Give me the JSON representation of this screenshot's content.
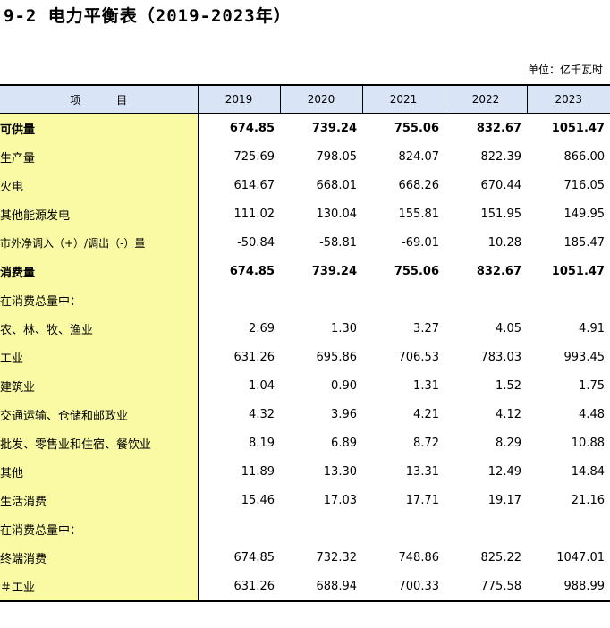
{
  "title": "9-2  电力平衡表（2019-2023年）",
  "unit": "单位：亿千瓦时",
  "table": {
    "header_item": "项   目",
    "years": [
      "2019",
      "2020",
      "2021",
      "2022",
      "2023"
    ]
  },
  "rows": [
    {
      "label": "可供量",
      "level": 0,
      "bold": true,
      "values": [
        "674.85",
        "739.24",
        "755.06",
        "832.67",
        "1051.47"
      ]
    },
    {
      "label": "生产量",
      "level": 1,
      "bold": false,
      "values": [
        "725.69",
        "798.05",
        "824.07",
        "822.39",
        "866.00"
      ]
    },
    {
      "label": "火电",
      "level": 2,
      "bold": false,
      "values": [
        "614.67",
        "668.01",
        "668.26",
        "670.44",
        "716.05"
      ]
    },
    {
      "label": "其他能源发电",
      "level": 2,
      "bold": false,
      "values": [
        "111.02",
        "130.04",
        "155.81",
        "151.95",
        "149.95"
      ]
    },
    {
      "label": "市外净调入（+）/调出（-）量",
      "level": 3,
      "bold": false,
      "values": [
        "-50.84",
        "-58.81",
        "-69.01",
        "10.28",
        "185.47"
      ]
    },
    {
      "label": "消费量",
      "level": 0,
      "bold": true,
      "values": [
        "674.85",
        "739.24",
        "755.06",
        "832.67",
        "1051.47"
      ]
    },
    {
      "label": "在消费总量中：",
      "level": 1,
      "bold": false,
      "values": [
        "",
        "",
        "",
        "",
        ""
      ]
    },
    {
      "label": "农、林、牧、渔业",
      "level": 2,
      "bold": false,
      "values": [
        "2.69",
        "1.30",
        "3.27",
        "4.05",
        "4.91"
      ]
    },
    {
      "label": "工业",
      "level": 2,
      "bold": false,
      "values": [
        "631.26",
        "695.86",
        "706.53",
        "783.03",
        "993.45"
      ]
    },
    {
      "label": "建筑业",
      "level": 2,
      "bold": false,
      "values": [
        "1.04",
        "0.90",
        "1.31",
        "1.52",
        "1.75"
      ]
    },
    {
      "label": "交通运输、仓储和邮政业",
      "level": 2,
      "bold": false,
      "values": [
        "4.32",
        "3.96",
        "4.21",
        "4.12",
        "4.48"
      ]
    },
    {
      "label": "批发、零售业和住宿、餐饮业",
      "level": 2,
      "bold": false,
      "values": [
        "8.19",
        "6.89",
        "8.72",
        "8.29",
        "10.88"
      ]
    },
    {
      "label": "其他",
      "level": 2,
      "bold": false,
      "values": [
        "11.89",
        "13.30",
        "13.31",
        "12.49",
        "14.84"
      ]
    },
    {
      "label": "生活消费",
      "level": 2,
      "bold": false,
      "values": [
        "15.46",
        "17.03",
        "17.71",
        "19.17",
        "21.16"
      ]
    },
    {
      "label": "在消费总量中：",
      "level": 1,
      "bold": false,
      "values": [
        "",
        "",
        "",
        "",
        ""
      ]
    },
    {
      "label": "终端消费",
      "level": 2,
      "bold": false,
      "values": [
        "674.85",
        "732.32",
        "748.86",
        "825.22",
        "1047.01"
      ]
    },
    {
      "label": "＃工业",
      "level": 2,
      "bold": false,
      "values": [
        "631.26",
        "688.94",
        "700.33",
        "775.58",
        "988.99"
      ]
    }
  ],
  "colors": {
    "label_column_bg": "#fafaa5",
    "header_bg": "#d9e5f7"
  }
}
